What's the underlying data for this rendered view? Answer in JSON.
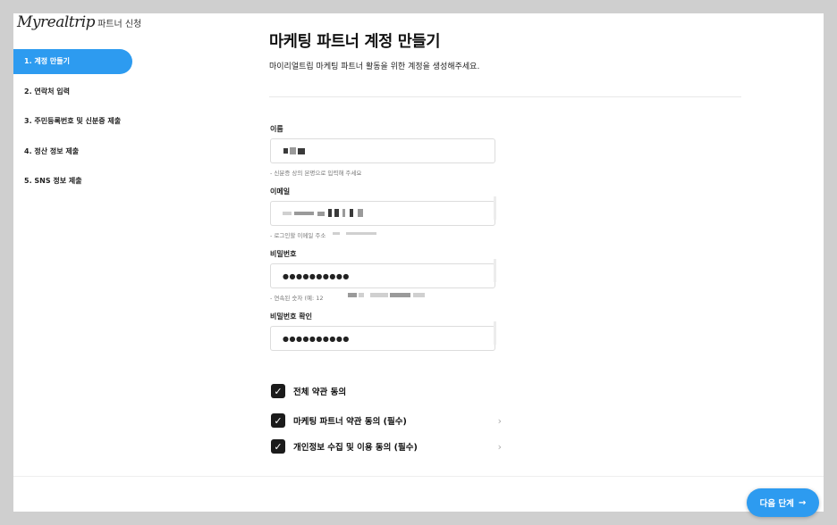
{
  "brand": {
    "logo": "Myrealtrip",
    "subtitle": "파트너 신청"
  },
  "sidebar": {
    "steps": [
      {
        "label": "1. 계정 만들기",
        "active": true
      },
      {
        "label": "2. 연락처 입력",
        "active": false
      },
      {
        "label": "3. 주민등록번호 및 신분증 제출",
        "active": false
      },
      {
        "label": "4. 정산 정보 제출",
        "active": false
      },
      {
        "label": "5. SNS 정보 제출",
        "active": false
      }
    ]
  },
  "page": {
    "title": "마케팅 파트너 계정 만들기",
    "subtitle": "마이리얼트립 마케팅 파트너 활동을 위한 계정을 생성해주세요."
  },
  "form": {
    "name": {
      "label": "이름",
      "hint": "- 신분증 상의 본명으로 입력해 주세요"
    },
    "email": {
      "label": "이메일",
      "hint": "- 로그인할 이메일 주소"
    },
    "password": {
      "label": "비밀번호",
      "value_mask": "●●●●●●●●●●",
      "hint": "- 연속된 숫자 (예: 12"
    },
    "password_confirm": {
      "label": "비밀번호 확인",
      "value_mask": "●●●●●●●●●●"
    }
  },
  "agreements": {
    "all": {
      "label": "전체 약관 동의",
      "checked": true
    },
    "items": [
      {
        "label": "마케팅 파트너 약관 동의 (필수)",
        "checked": true,
        "chevron": "›"
      },
      {
        "label": "개인정보 수집 및 이용 동의 (필수)",
        "checked": true,
        "chevron": "›"
      }
    ],
    "check_glyph": "✓"
  },
  "footer": {
    "next_label": "다음 단계",
    "next_arrow": "→"
  },
  "colors": {
    "accent": "#2d9bf0",
    "checkbox": "#1b1b1b"
  }
}
